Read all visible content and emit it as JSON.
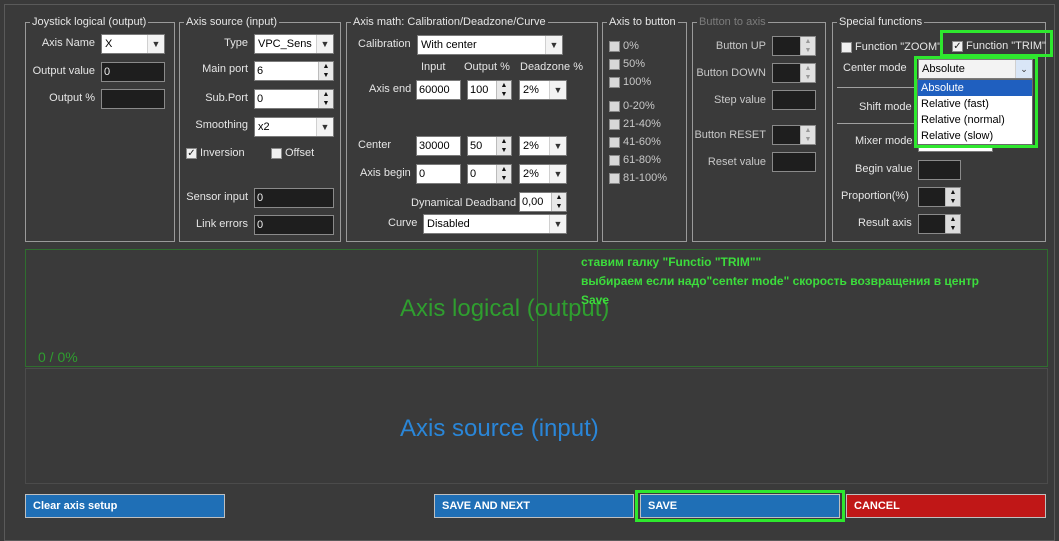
{
  "joystick_logical": {
    "title": "Joystick logical (output)",
    "axis_name_label": "Axis Name",
    "axis_name_value": "X",
    "output_value_label": "Output value",
    "output_value": "0",
    "output_pct_label": "Output %",
    "output_pct": ""
  },
  "axis_source": {
    "title": "Axis source (input)",
    "type_label": "Type",
    "type_value": "VPC_Sens",
    "main_port_label": "Main port",
    "main_port_value": "6",
    "sub_port_label": "Sub.Port",
    "sub_port_value": "0",
    "smoothing_label": "Smoothing",
    "smoothing_value": "x2",
    "inversion_label": "Inversion",
    "inversion_checked": true,
    "offset_label": "Offset",
    "offset_checked": false,
    "sensor_input_label": "Sensor input",
    "sensor_input_value": "0",
    "link_errors_label": "Link errors",
    "link_errors_value": "0"
  },
  "axis_math": {
    "title": "Axis math: Calibration/Deadzone/Curve",
    "calibration_label": "Calibration",
    "calibration_value": "With center",
    "col_input": "Input",
    "col_output": "Output %",
    "col_deadzone": "Deadzone %",
    "axis_end_label": "Axis end",
    "axis_end_input": "60000",
    "axis_end_output": "100",
    "axis_end_deadzone": "2%",
    "center_label": "Center",
    "center_input": "30000",
    "center_output": "50",
    "center_deadzone": "2%",
    "axis_begin_label": "Axis begin",
    "axis_begin_input": "0",
    "axis_begin_output": "0",
    "axis_begin_deadzone": "2%",
    "dyn_deadband_label": "Dynamical Deadband",
    "dyn_deadband_value": "0,00",
    "curve_label": "Curve",
    "curve_value": "Disabled"
  },
  "axis_to_button": {
    "title": "Axis to button",
    "options_a": [
      "0%",
      "50%",
      "100%"
    ],
    "options_b": [
      "0-20%",
      "21-40%",
      "41-60%",
      "61-80%",
      "81-100%"
    ]
  },
  "button_to_axis": {
    "title": "Button to axis",
    "button_up_label": "Button UP",
    "button_down_label": "Button DOWN",
    "step_value_label": "Step value",
    "button_reset_label": "Button RESET",
    "reset_value_label": "Reset value"
  },
  "special_functions": {
    "title": "Special functions",
    "zoom_label": "Function \"ZOOM\"",
    "zoom_checked": false,
    "trim_label": "Function \"TRIM\"",
    "trim_checked": true,
    "center_mode_label": "Center mode",
    "center_mode_value": "Absolute",
    "center_mode_options": [
      "Absolute",
      "Relative (fast)",
      "Relative (normal)",
      "Relative (slow)"
    ],
    "shift_mode_label": "Shift mode",
    "mixer_mode_label": "Mixer mode",
    "begin_value_label": "Begin value",
    "proportion_label": "Proportion(%)",
    "result_axis_label": "Result axis"
  },
  "graph": {
    "output_label": "Axis logical (output)",
    "output_readout": "0 / 0%",
    "input_label": "Axis source (input)"
  },
  "annotation": {
    "line1": "ставим галку  \"Functio \"TRIM\"\"",
    "line2": "выбираем если надо\"center mode\" скорость возвращения в центр",
    "line3": "Save"
  },
  "buttons": {
    "clear": "Clear axis setup",
    "save_next": "SAVE AND NEXT",
    "save": "SAVE",
    "cancel": "CANCEL"
  },
  "colors": {
    "background": "#3a3a3a",
    "button_blue": "#1f6fb6",
    "button_red": "#c01717",
    "highlight_green": "#2ee82e",
    "output_green": "#2f9e2f",
    "input_blue": "#2a86d8"
  }
}
